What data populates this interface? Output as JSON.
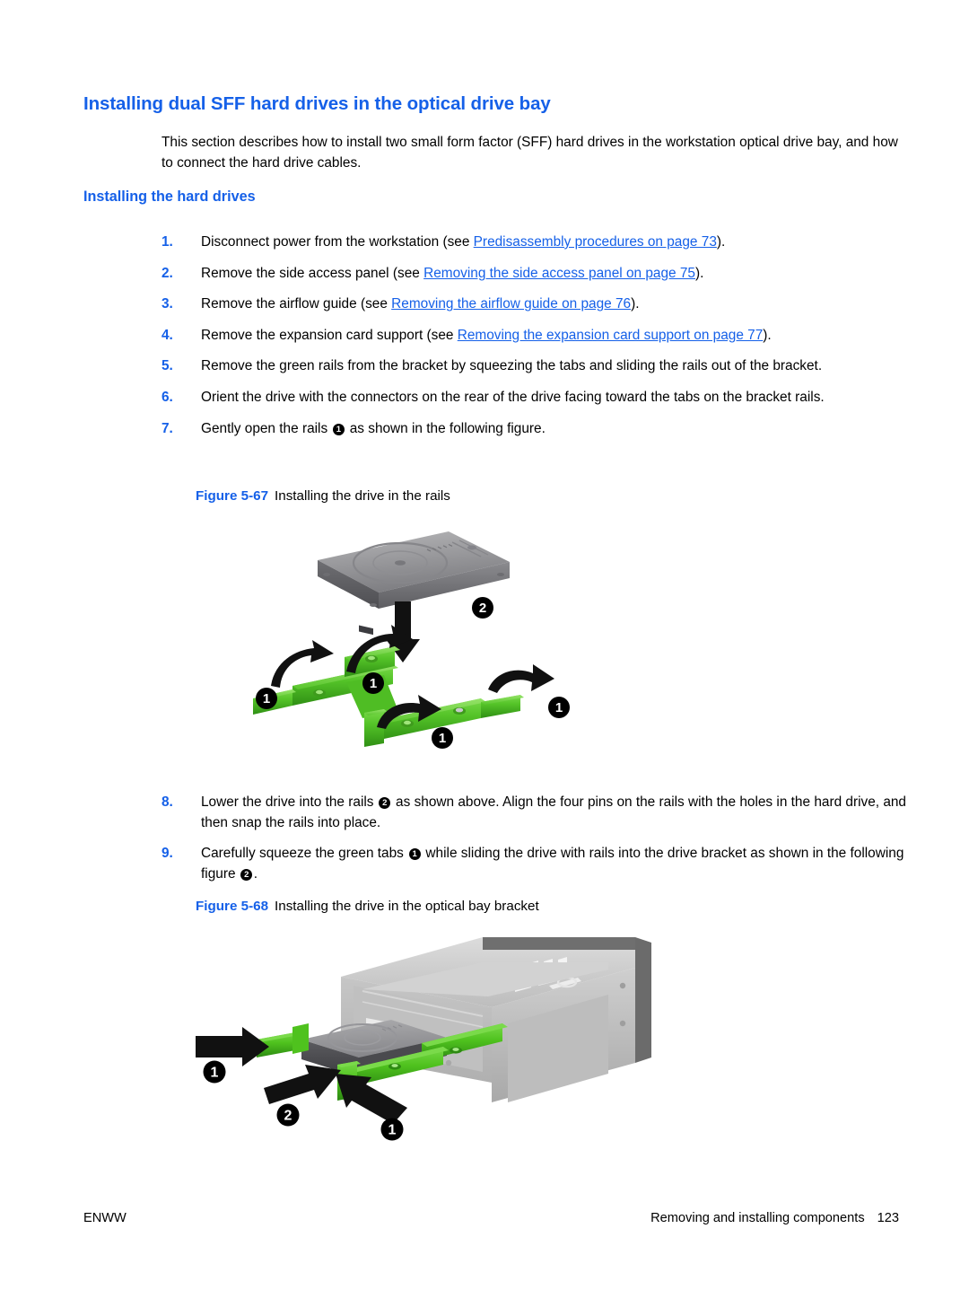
{
  "colors": {
    "heading_blue": "#1560e8",
    "link_blue": "#1560e8",
    "rail_green": "#5cc832",
    "rail_green_dark": "#2f8f14",
    "drive_gray": "#9a9a9c",
    "bracket_gray": "#c9c9c9",
    "text_black": "#000000",
    "page_background": "#ffffff"
  },
  "heading": {
    "title": "Installing dual SFF hard drives in the optical drive bay",
    "intro": "This section describes how to install two small form factor (SFF) hard drives in the workstation optical drive bay, and how to connect the hard drive cables.",
    "subheading": "Installing the hard drives"
  },
  "steps": [
    {
      "number": "1.",
      "parts": [
        {
          "type": "text",
          "value": "Disconnect power from the workstation (see "
        },
        {
          "type": "link",
          "value": "Predisassembly procedures on page 73"
        },
        {
          "type": "text",
          "value": ")."
        }
      ]
    },
    {
      "number": "2.",
      "parts": [
        {
          "type": "text",
          "value": "Remove the side access panel (see "
        },
        {
          "type": "link",
          "value": "Removing the side access panel on page 75"
        },
        {
          "type": "text",
          "value": ")."
        }
      ]
    },
    {
      "number": "3.",
      "parts": [
        {
          "type": "text",
          "value": "Remove the airflow guide (see "
        },
        {
          "type": "link",
          "value": "Removing the airflow guide on page 76"
        },
        {
          "type": "text",
          "value": ")."
        }
      ]
    },
    {
      "number": "4.",
      "parts": [
        {
          "type": "text",
          "value": "Remove the expansion card support (see "
        },
        {
          "type": "link",
          "value": "Removing the expansion card support on page 77"
        },
        {
          "type": "text",
          "value": ")."
        }
      ]
    },
    {
      "number": "5.",
      "parts": [
        {
          "type": "text",
          "value": "Remove the green rails from the bracket by squeezing the tabs and sliding the rails out of the bracket."
        }
      ]
    },
    {
      "number": "6.",
      "parts": [
        {
          "type": "text",
          "value": "Orient the drive with the connectors on the rear of the drive facing toward the tabs on the bracket rails."
        }
      ]
    },
    {
      "number": "7.",
      "parts": [
        {
          "type": "text",
          "value": "Gently open the rails "
        },
        {
          "type": "callout",
          "value": "1"
        },
        {
          "type": "text",
          "value": " as shown in the following figure."
        }
      ]
    },
    {
      "number": "8.",
      "parts": [
        {
          "type": "text",
          "value": "Lower the drive into the rails "
        },
        {
          "type": "callout",
          "value": "2"
        },
        {
          "type": "text",
          "value": " as shown above. Align the four pins on the rails with the holes in the hard drive, and then snap the rails into place."
        }
      ]
    },
    {
      "number": "9.",
      "parts": [
        {
          "type": "text",
          "value": "Carefully squeeze the green tabs "
        },
        {
          "type": "callout",
          "value": "1"
        },
        {
          "type": "text",
          "value": " while sliding the drive with rails into the drive bracket as shown in the following figure "
        },
        {
          "type": "callout",
          "value": "2"
        },
        {
          "type": "text",
          "value": "."
        }
      ]
    }
  ],
  "figures": [
    {
      "label": "Figure 5-67",
      "caption": "Installing the drive in the rails",
      "callouts": [
        "1",
        "1",
        "1",
        "1",
        "2"
      ],
      "alt": "Hard drive lowered into two green plastic rails with arrows"
    },
    {
      "label": "Figure 5-68",
      "caption": "Installing the drive in the optical bay bracket",
      "callouts": [
        "1",
        "2",
        "1"
      ],
      "alt": "Drive with green rails sliding into the optical bay bracket"
    }
  ],
  "footer": {
    "left": "ENWW",
    "right": "Removing and installing components",
    "page_number": "123"
  }
}
